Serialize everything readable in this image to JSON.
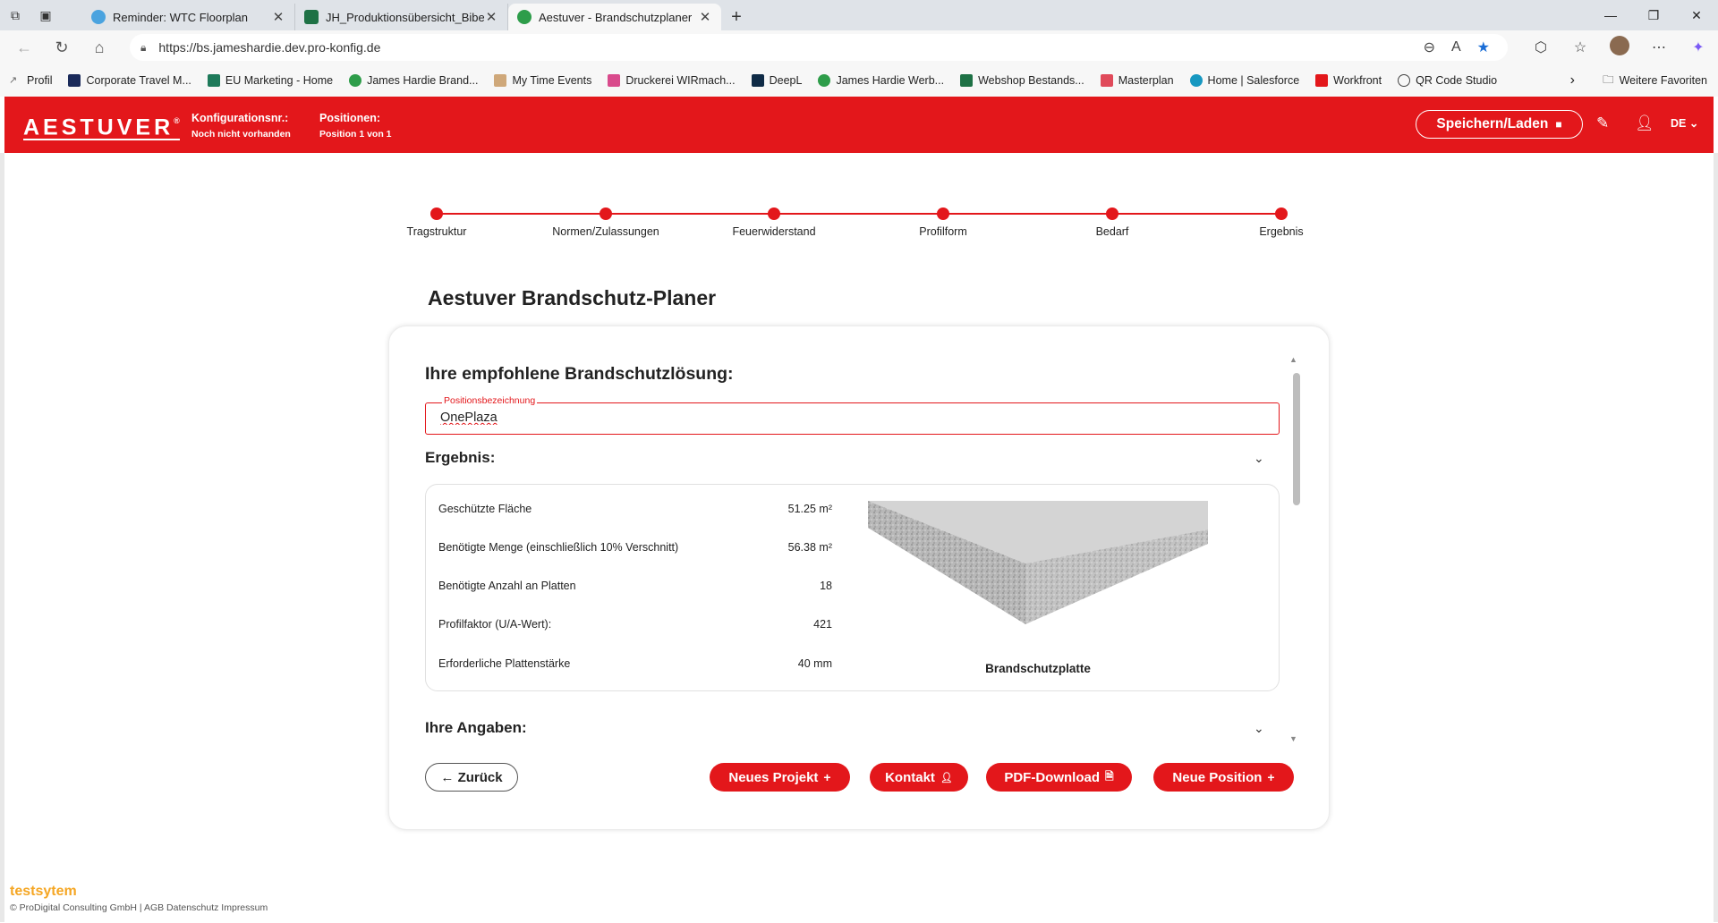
{
  "browser": {
    "tabs": [
      {
        "title": "Reminder: WTC Floorplan",
        "fav_color": "#4aa3df"
      },
      {
        "title": "JH_Produktionsübersicht_Bibel_SF",
        "fav_color": "#1e7145"
      },
      {
        "title": "Aestuver - Brandschutzplaner",
        "fav_color": "#2e9d4a"
      }
    ],
    "url": "https://bs.jameshardie.dev.pro-konfig.de",
    "bookmarks": [
      {
        "label": "Profil",
        "color": "#666"
      },
      {
        "label": "Corporate Travel M...",
        "color": "#1a2a5a"
      },
      {
        "label": "EU Marketing - Home",
        "color": "#1e7a5a"
      },
      {
        "label": "James Hardie Brand...",
        "color": "#2e9d4a"
      },
      {
        "label": "My Time Events",
        "color": "#cfa87a"
      },
      {
        "label": "Druckerei WIRmach...",
        "color": "#d94a8c"
      },
      {
        "label": "DeepL",
        "color": "#0f2b46"
      },
      {
        "label": "James Hardie Werb...",
        "color": "#2e9d4a"
      },
      {
        "label": "Webshop Bestands...",
        "color": "#1e7145"
      },
      {
        "label": "Masterplan",
        "color": "#e04a5a"
      },
      {
        "label": "Home | Salesforce",
        "color": "#1798c1"
      },
      {
        "label": "Workfront",
        "color": "#e3171b"
      },
      {
        "label": "QR Code Studio",
        "color": "#444"
      }
    ],
    "other_favorites": "Weitere Favoriten"
  },
  "header": {
    "logo": "AESTUVER",
    "config_label": "Konfigurationsnr.:",
    "config_value": "Noch nicht vorhanden",
    "positions_label": "Positionen:",
    "positions_value": "Position 1 von 1",
    "save_label": "Speichern/Laden",
    "lang": "DE"
  },
  "steps": [
    "Tragstruktur",
    "Normen/Zulassungen",
    "Feuerwiderstand",
    "Profilform",
    "Bedarf",
    "Ergebnis"
  ],
  "page_title": "Aestuver Brandschutz-Planer",
  "card": {
    "heading": "Ihre empfohlene Brandschutzlösung:",
    "field_label": "Positionsbezeichnung",
    "field_value": "OnePlaza",
    "result_heading": "Ergebnis:",
    "results": [
      {
        "label": "Geschützte Fläche",
        "value": "51.25 m²"
      },
      {
        "label": "Benötigte Menge (einschließlich 10% Verschnitt)",
        "value": "56.38 m²"
      },
      {
        "label": "Benötigte Anzahl an Platten",
        "value": "18"
      },
      {
        "label": "Profilfaktor (U/A-Wert):",
        "value": "421"
      },
      {
        "label": "Erforderliche Plattenstärke",
        "value": "40 mm"
      }
    ],
    "product_caption": "Brandschutzplatte",
    "inputs_heading": "Ihre Angaben:",
    "btn_back": "← Zurück",
    "btn_new_project": "Neues Projekt",
    "btn_contact": "Kontakt",
    "btn_pdf": "PDF-Download",
    "btn_new_position": "Neue Position"
  },
  "footer": {
    "brand": "testsytem",
    "copyright": "© ProDigital Consulting GmbH | AGB Datenschutz Impressum"
  },
  "colors": {
    "brand_red": "#e3171b",
    "footer_brand": "#f5a623"
  }
}
